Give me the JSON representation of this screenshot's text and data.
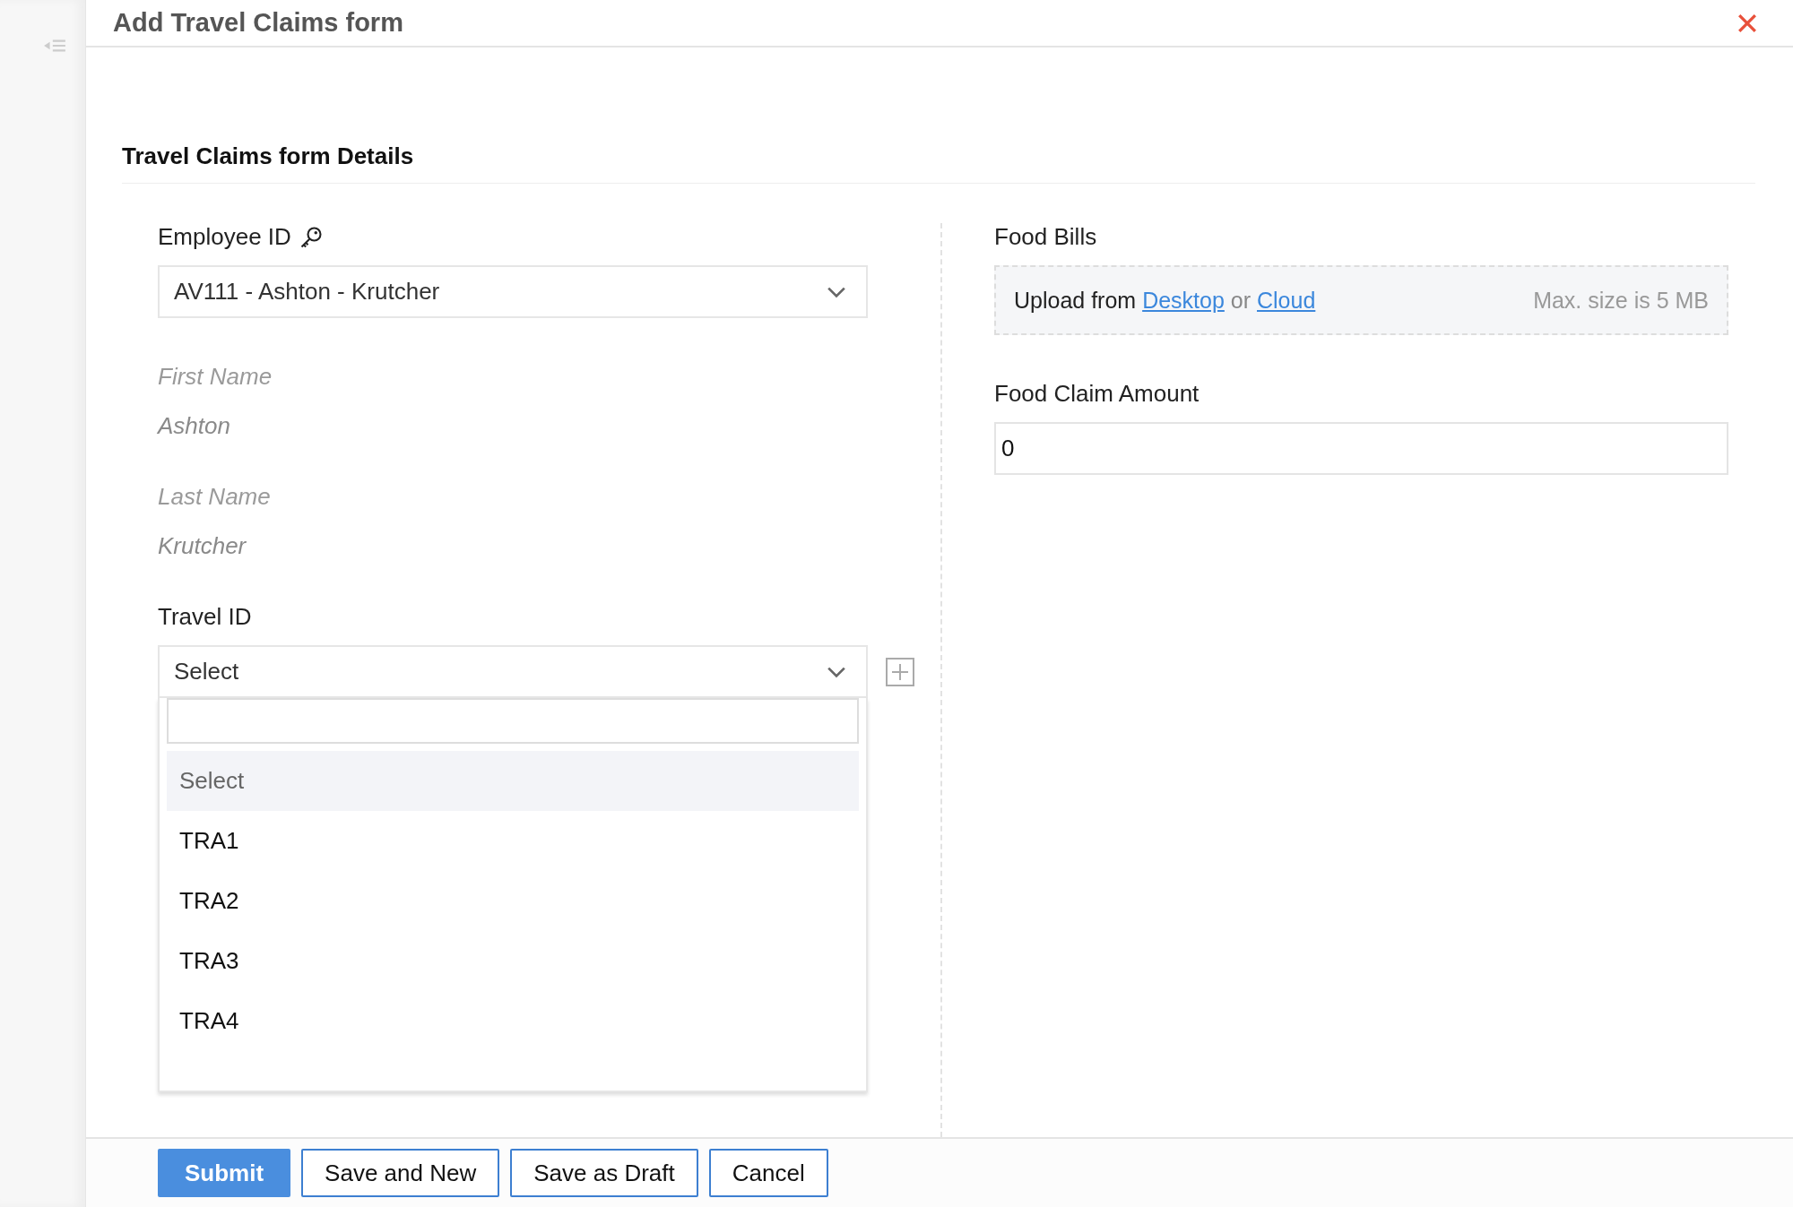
{
  "window": {
    "title": "Add Travel Claims form"
  },
  "section": {
    "title": "Travel Claims form Details"
  },
  "left_fields": [
    {
      "kind": "select",
      "label": "Employee ID",
      "key_icon": true,
      "value": "AV111 - Ashton - Krutcher"
    },
    {
      "kind": "readonly",
      "label": "First Name",
      "value": "Ashton"
    },
    {
      "kind": "readonly",
      "label": "Last Name",
      "value": "Krutcher"
    },
    {
      "kind": "lookup",
      "label": "Travel ID",
      "value": "Select",
      "expanded": true,
      "options": [
        {
          "label": "Select",
          "selected": true
        },
        {
          "label": "TRA1",
          "selected": false
        },
        {
          "label": "TRA2",
          "selected": false
        },
        {
          "label": "TRA3",
          "selected": false
        },
        {
          "label": "TRA4",
          "selected": false
        }
      ]
    }
  ],
  "right_fields": [
    {
      "kind": "upload",
      "label": "Food Bills",
      "prefix": "Upload from",
      "link_1": "Desktop",
      "joiner": "or",
      "link_2": "Cloud",
      "hint": "Max. size is 5 MB"
    },
    {
      "kind": "input",
      "label": "Food Claim Amount",
      "value": "0"
    }
  ],
  "buttons": [
    {
      "label": "Submit",
      "kind": "primary"
    },
    {
      "label": "Save and New",
      "kind": "secondary"
    },
    {
      "label": "Save as Draft",
      "kind": "secondary"
    },
    {
      "label": "Cancel",
      "kind": "secondary"
    }
  ]
}
